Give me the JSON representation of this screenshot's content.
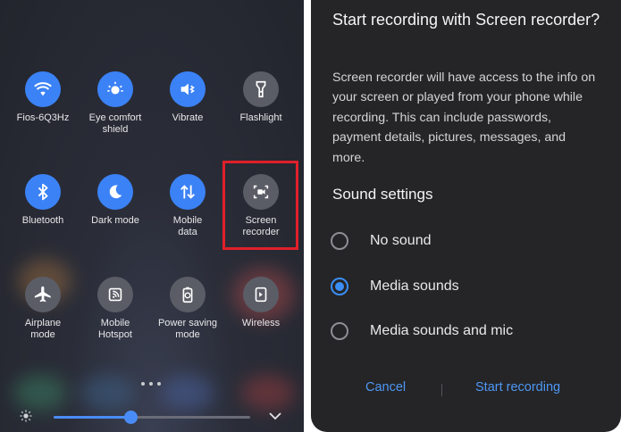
{
  "quick_settings": {
    "tiles": [
      {
        "label": "Fios-6Q3Hz",
        "icon": "wifi-icon",
        "active": true
      },
      {
        "label": "Eye comfort\nshield",
        "icon": "eye-comfort-icon",
        "active": true
      },
      {
        "label": "Vibrate",
        "icon": "vibrate-icon",
        "active": true
      },
      {
        "label": "Flashlight",
        "icon": "flashlight-icon",
        "active": false
      },
      {
        "label": "Bluetooth",
        "icon": "bluetooth-icon",
        "active": true
      },
      {
        "label": "Dark mode",
        "icon": "moon-icon",
        "active": true
      },
      {
        "label": "Mobile\ndata",
        "icon": "mobile-data-icon",
        "active": true
      },
      {
        "label": "Screen\nrecorder",
        "icon": "screen-recorder-icon",
        "active": false
      },
      {
        "label": "Airplane\nmode",
        "icon": "airplane-icon",
        "active": false
      },
      {
        "label": "Mobile\nHotspot",
        "icon": "hotspot-icon",
        "active": false
      },
      {
        "label": "Power saving\nmode",
        "icon": "power-saving-icon",
        "active": false
      },
      {
        "label": "Wireless",
        "icon": "wireless-share-icon",
        "active": false
      }
    ],
    "brightness_level": 0.39,
    "colors": {
      "active": "#3b82f6",
      "inactive": "#5a5d66",
      "highlight": "#e0202a"
    }
  },
  "dialog": {
    "title": "Start recording with Screen recorder?",
    "body": "Screen recorder will have access to the info on your screen or played from your phone while recording. This can include passwords, payment details, pictures, messages, and more.",
    "section_title": "Sound settings",
    "options": [
      {
        "label": "No sound",
        "checked": false
      },
      {
        "label": "Media sounds",
        "checked": true
      },
      {
        "label": "Media sounds and mic",
        "checked": false
      }
    ],
    "cancel_label": "Cancel",
    "confirm_label": "Start recording",
    "colors": {
      "accent": "#3a8ef6",
      "background": "#252527"
    }
  }
}
